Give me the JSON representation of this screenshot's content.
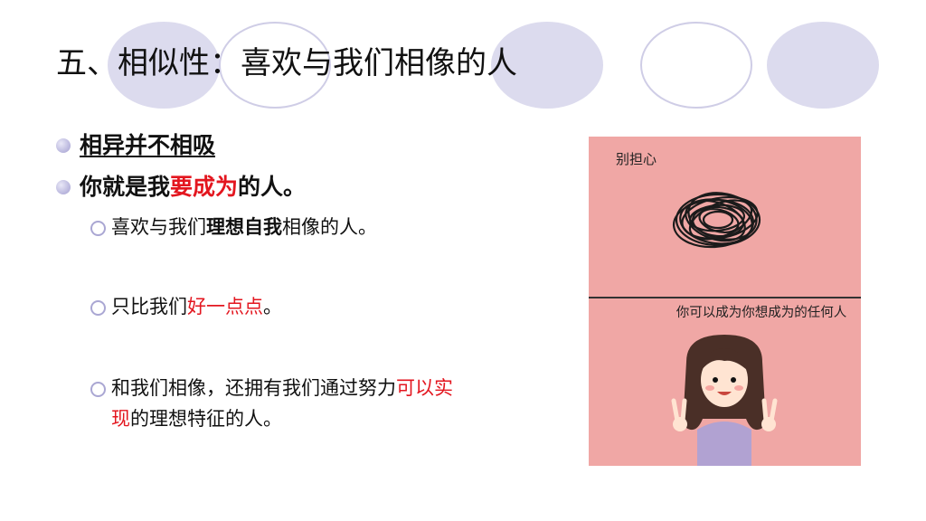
{
  "slide": {
    "title": "五、相似性：喜欢与我们相像的人",
    "bullets": [
      {
        "text": "相异并不相吸"
      },
      {
        "pre": "你就是我",
        "highlight": "要成为",
        "post": "的人。"
      }
    ],
    "subpoints": [
      {
        "pre": "喜欢与我们",
        "bold": "理想自我",
        "post": "相像的人。"
      },
      {
        "pre": "只比我们",
        "highlight": "好一点点",
        "post": "。"
      },
      {
        "pre": "和我们相像，还拥有我们通过努力",
        "highlight": "可以实",
        "line2_highlight": "现",
        "line2_post": "的理想特征的人。"
      }
    ]
  },
  "illustration": {
    "caption_top": "别担心",
    "caption_bottom": "你可以成为你想成为的任何人",
    "background_color": "#f0a7a5"
  },
  "colors": {
    "accent_red": "#e3161f",
    "decor_lavender": "#dcdbee",
    "bullet_purple": "#b7b4dc"
  }
}
